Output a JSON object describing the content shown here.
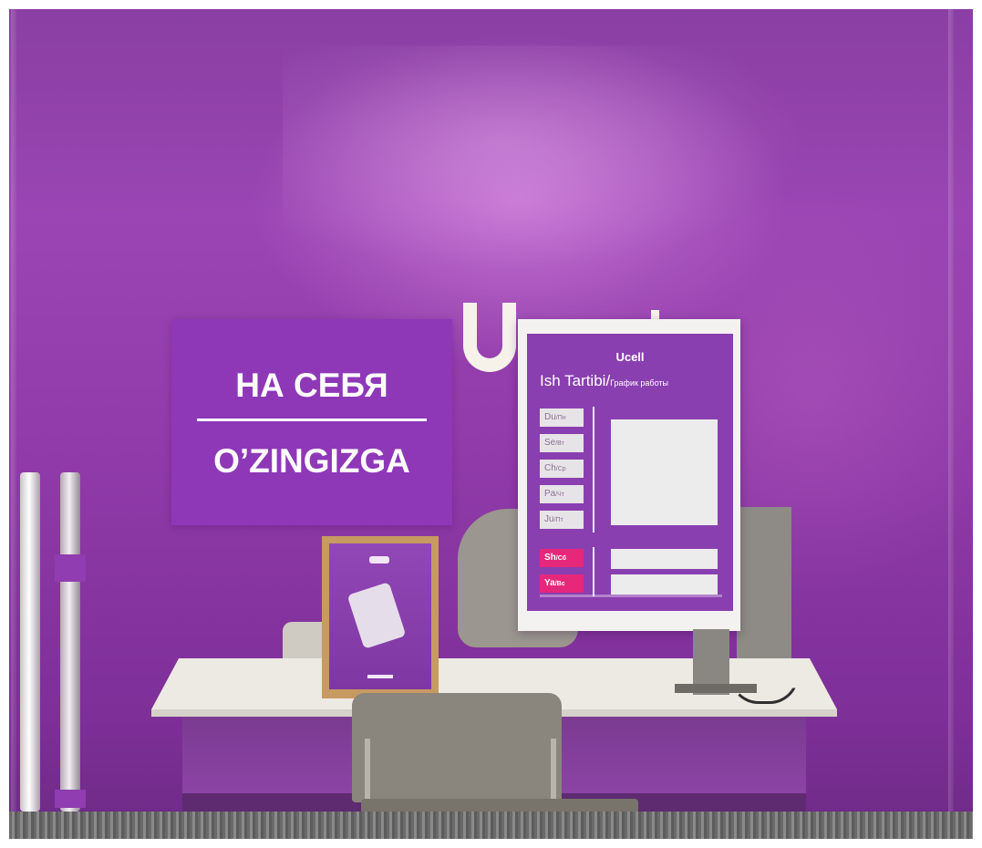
{
  "scene": {
    "description_colors": {
      "wall": "#8f3aa8",
      "sign_purple": "#8e38b8",
      "weekend_pink": "#e6287a",
      "desk_white": "#ede9e3"
    }
  },
  "slogan_sign": {
    "top_text": "НА СЕБЯ",
    "bottom_text": "O’ZINGIZGA"
  },
  "schedule_panel": {
    "brand": "Ucell",
    "title": "Ish Tartibi/",
    "title_small": "График работы",
    "weekdays": [
      {
        "label": "Du",
        "sub": "/Пн"
      },
      {
        "label": "Se",
        "sub": "/Вт"
      },
      {
        "label": "Ch",
        "sub": "/Ср"
      },
      {
        "label": "Pa",
        "sub": "/Чт"
      },
      {
        "label": "Ju",
        "sub": "/Пт"
      }
    ],
    "weekend": [
      {
        "label": "Sh",
        "sub": "/Сб"
      },
      {
        "label": "Ya",
        "sub": "/Вс"
      }
    ]
  },
  "letter": "U"
}
